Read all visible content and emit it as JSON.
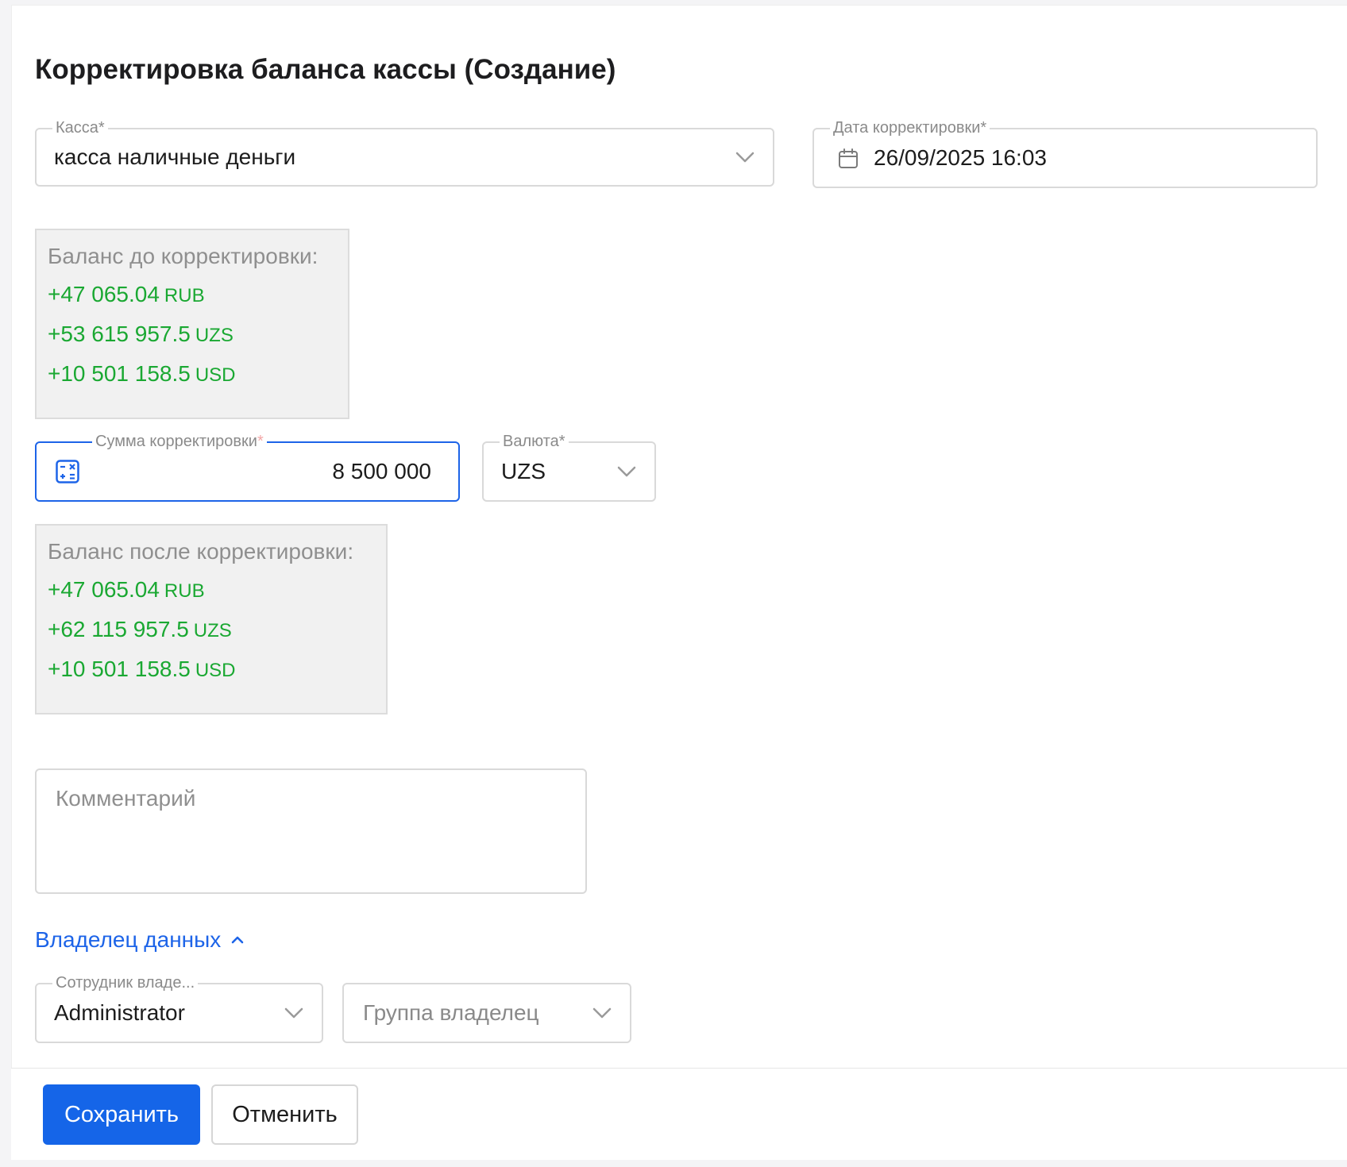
{
  "form": {
    "title": "Корректировка баланса кассы (Создание)"
  },
  "cashbox": {
    "label": "Касса",
    "required_mark": "*",
    "value": "касса наличные деньги"
  },
  "date": {
    "label": "Дата корректировки",
    "required_mark": "*",
    "value": "26/09/2025 16:03"
  },
  "balance_before": {
    "heading": "Баланс до корректировки:",
    "lines": [
      {
        "amount": "+47 065.04",
        "currency": "RUB"
      },
      {
        "amount": "+53 615 957.5",
        "currency": "UZS"
      },
      {
        "amount": "+10 501 158.5",
        "currency": "USD"
      }
    ]
  },
  "amount": {
    "label": "Сумма корректировки",
    "required_mark": "*",
    "value": "8 500 000"
  },
  "currency": {
    "label": "Валюта",
    "required_mark": "*",
    "value": "UZS"
  },
  "balance_after": {
    "heading": "Баланс после корректировки:",
    "lines": [
      {
        "amount": "+47 065.04",
        "currency": "RUB"
      },
      {
        "amount": "+62 115 957.5",
        "currency": "UZS"
      },
      {
        "amount": "+10 501 158.5",
        "currency": "USD"
      }
    ]
  },
  "comment": {
    "placeholder": "Комментарий"
  },
  "data_owner": {
    "section_label": "Владелец данных",
    "expanded": true,
    "employee": {
      "label": "Сотрудник владе...",
      "value": "Administrator"
    },
    "group": {
      "placeholder": "Группа владелец"
    }
  },
  "actions": {
    "save_label": "Сохранить",
    "cancel_label": "Отменить"
  },
  "colors": {
    "accent": "#1565e8",
    "positive": "#1aa832",
    "muted": "#8f8f8f",
    "border": "#d9d9d9",
    "required_pink": "#f3a7a7"
  },
  "icons": {
    "dropdown": "chevron-down-icon",
    "date": "calendar-icon",
    "amount": "calculator-icon",
    "section_toggle": "chevron-up-icon"
  }
}
